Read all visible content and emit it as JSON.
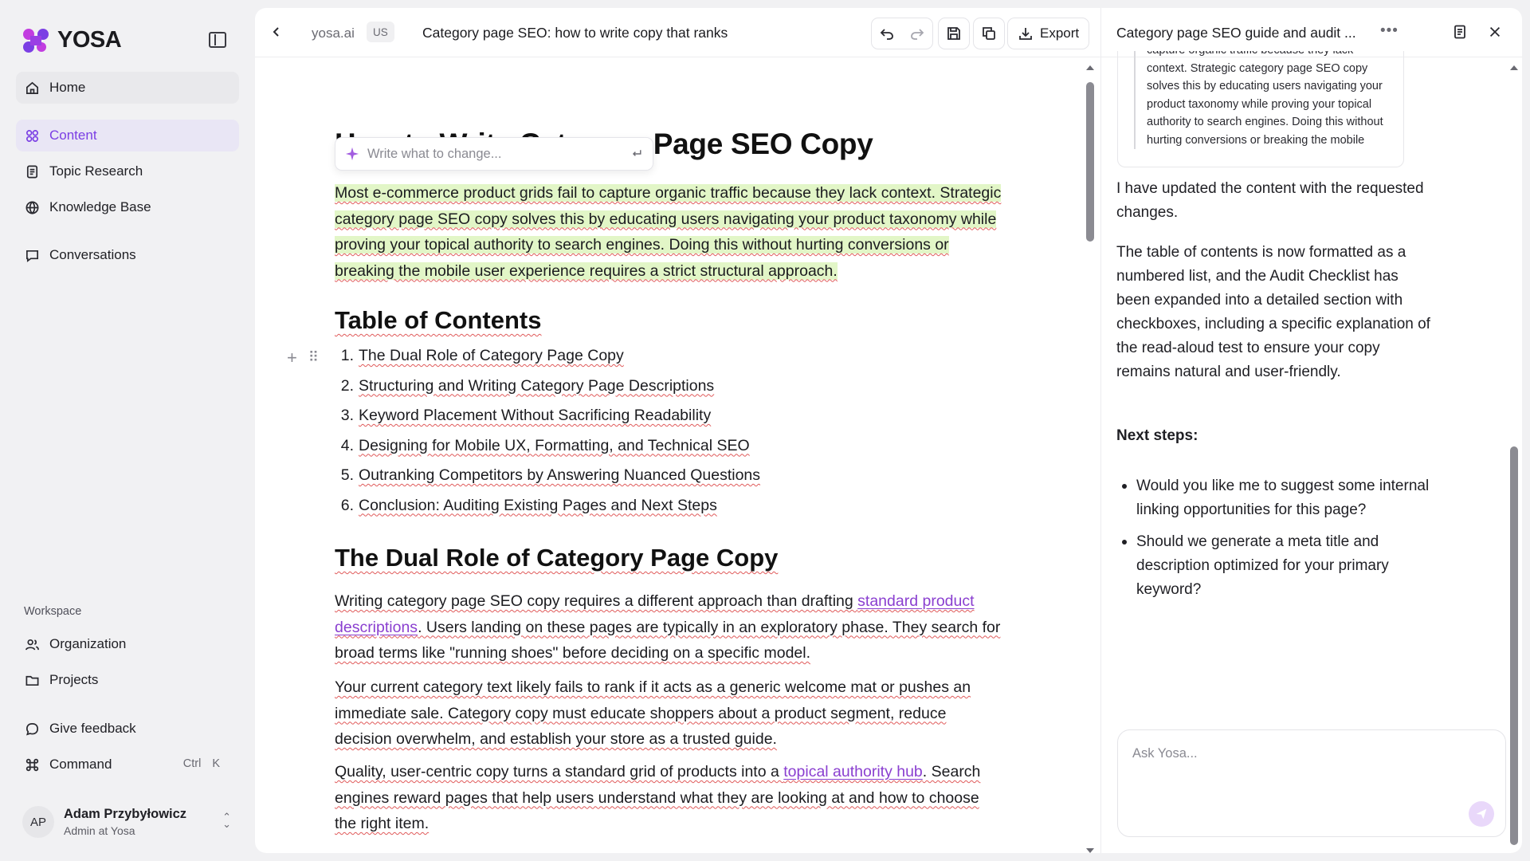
{
  "colors": {
    "accent": "#7b3fe4",
    "highlight": "#e2f6c7",
    "link": "#8a3fd0",
    "spellcheck": "#e05a5a"
  },
  "brand": {
    "name": "YOSA"
  },
  "sidebar": {
    "primary": [
      {
        "label": "Home",
        "icon": "home-icon"
      },
      {
        "label": "Content",
        "icon": "content-icon",
        "active": true
      },
      {
        "label": "Topic Research",
        "icon": "document-icon"
      },
      {
        "label": "Knowledge Base",
        "icon": "globe-icon"
      },
      {
        "label": "Conversations",
        "icon": "chat-bubble-icon"
      }
    ],
    "workspace_label": "Workspace",
    "workspace": [
      {
        "label": "Organization",
        "icon": "users-icon"
      },
      {
        "label": "Projects",
        "icon": "folder-icon"
      }
    ],
    "feedback": {
      "label": "Give feedback",
      "icon": "feedback-icon"
    },
    "command": {
      "label": "Command",
      "icon": "command-icon",
      "shortcut_mod": "Ctrl",
      "shortcut_key": "K"
    },
    "user": {
      "initials": "AP",
      "name": "Adam Przybyłowicz",
      "role": "Admin at Yosa"
    }
  },
  "editor": {
    "domain": "yosa.ai",
    "locale": "US",
    "doc_title": "Category page SEO: how to write copy that ranks",
    "export_label": "Export",
    "h1": "How to Write Category Page SEO Copy",
    "change_placeholder": "Write what to change...",
    "intro": "Most e-commerce product grids fail to capture organic traffic because they lack context. Strategic category page SEO copy solves this by educating users navigating your product taxonomy while proving your topical authority to search engines. Doing this without hurting conversions or breaking the mobile user experience requires a strict structural approach.",
    "toc_heading": "Table of Contents",
    "toc": [
      "The Dual Role of Category Page Copy",
      "Structuring and Writing Category Page Descriptions",
      "Keyword Placement Without Sacrificing Readability",
      "Designing for Mobile UX, Formatting, and Technical SEO",
      "Outranking Competitors by Answering Nuanced Questions",
      "Conclusion: Auditing Existing Pages and Next Steps"
    ],
    "section_heading": "The Dual Role of Category Page Copy",
    "p1": {
      "before": "Writing category page SEO copy requires a different approach than drafting ",
      "link": "standard product descriptions",
      "after": ". Users landing on these pages are typically in an exploratory phase. They search for broad terms like \"running shoes\" before deciding on a specific model."
    },
    "p2": "Your current category text likely fails to rank if it acts as a generic welcome mat or pushes an immediate sale. Category copy must educate shoppers about a product segment, reduce decision overwhelm, and establish your store as a trusted guide.",
    "p3": {
      "before": "Quality, user-centric copy turns a standard grid of products into a ",
      "link": "topical authority hub",
      "after": ". Search engines reward pages that help users understand what they are looking at and how to choose the right item."
    }
  },
  "chat": {
    "title": "Category page SEO guide and audit ...",
    "quote": "capture organic traffic because they lack context. Strategic category page SEO copy solves this by educating users navigating your product taxonomy while proving your topical authority to search engines. Doing this without hurting conversions or breaking the mobile",
    "msg1": "I have updated the content with the requested changes.",
    "msg2": "The table of contents is now formatted as a numbered list, and the Audit Checklist has been expanded into a detailed section with checkboxes, including a specific explanation of the read-aloud test to ensure your copy remains natural and user-friendly.",
    "next_steps_label": "Next steps:",
    "next_steps": [
      "Would you like me to suggest some internal linking opportunities for this page?",
      "Should we generate a meta title and description optimized for your primary keyword?"
    ],
    "composer_placeholder": "Ask Yosa..."
  }
}
